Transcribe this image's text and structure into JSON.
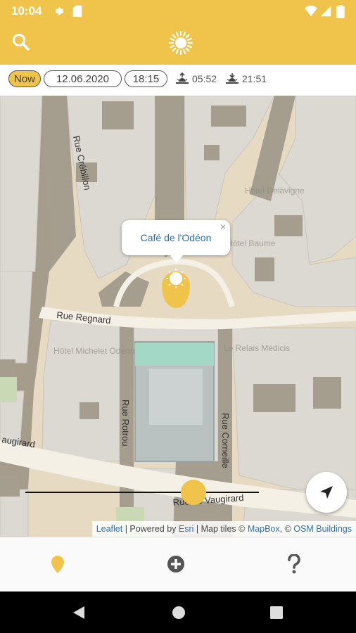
{
  "status_bar": {
    "time": "10:04"
  },
  "toolbar": {
    "now_label": "Now",
    "date": "12.06.2020",
    "time": "18:15",
    "sunrise": "05:52",
    "sunset": "21:51"
  },
  "map": {
    "streets": {
      "rue_crebillon": "Rue Crébillon",
      "rue_regnard": "Rue Regnard",
      "rue_rotrou": "Rue Rotrou",
      "rue_corneille": "Rue Corneille",
      "vaugirard_left": "augirard",
      "vaugirard_right": "Rue de Vaugirard"
    },
    "pois": {
      "hotel_delavigne": "Hôtel Delavigne",
      "hotel_baume": "Hôtel Baume",
      "hotel_michelet": "Hôtel Michelet Odéon",
      "le_relais": "Le Relais Médicis"
    },
    "popup_title": "Café de l'Odéon",
    "popup_close": "×",
    "time_slider_value": 0.72
  },
  "attribution": {
    "leaflet": "Leaflet",
    "sep1": " | Powered by ",
    "esri": "Esri",
    "sep2": " | Map tiles © ",
    "mapbox": "MapBox",
    "sep3": ", © ",
    "osm": "OSM Buildings"
  },
  "colors": {
    "accent": "#f0c34a",
    "link": "#2b72b0"
  },
  "icons": {
    "search": "search-icon",
    "sun": "sun-icon",
    "locate": "navigation-arrow-icon",
    "places": "map-pin-icon",
    "add": "add-circle-icon",
    "help": "help-icon"
  }
}
